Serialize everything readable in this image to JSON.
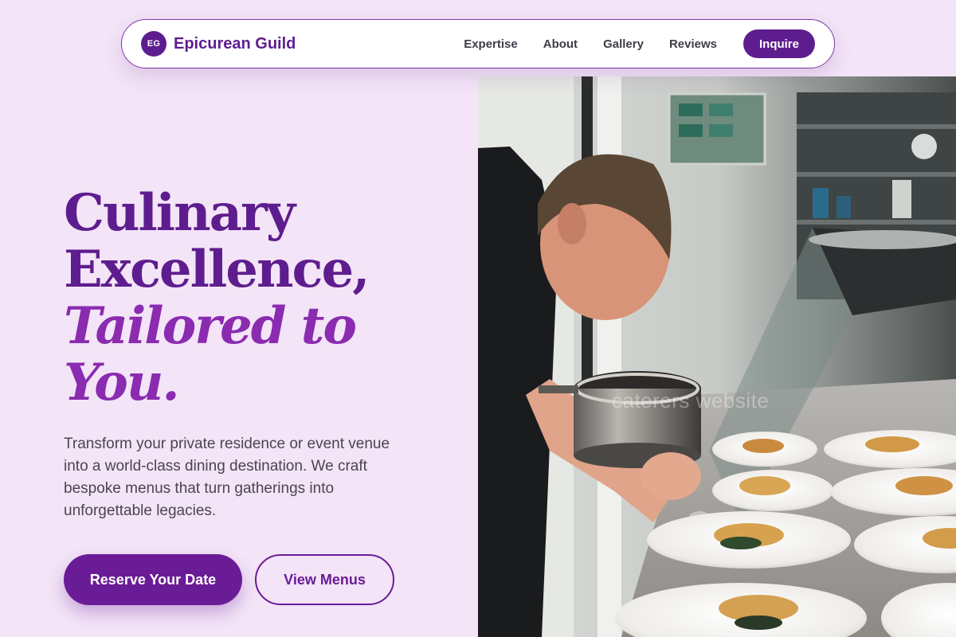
{
  "nav": {
    "badge": "EG",
    "brand": "Epicurean Guild",
    "links": [
      "Expertise",
      "About",
      "Gallery",
      "Reviews"
    ],
    "cta": "Inquire"
  },
  "hero": {
    "headline_1": "Culinary",
    "headline_2": "Excellence,",
    "headline_3": "Tailored to",
    "headline_4": "You.",
    "lead": "Transform your private residence or event venue into a world-class dining destination. We craft bespoke menus that turn gatherings into unforgettable legacies.",
    "primary_cta": "Reserve Your Date",
    "secondary_cta": "View Menus"
  },
  "photo": {
    "watermark": "caterers website",
    "subject": "chef-plating-dishes-photo"
  },
  "colors": {
    "background": "#f3e4f7",
    "brand_purple": "#5e1d8e",
    "accent_purple": "#8a2bb0"
  }
}
